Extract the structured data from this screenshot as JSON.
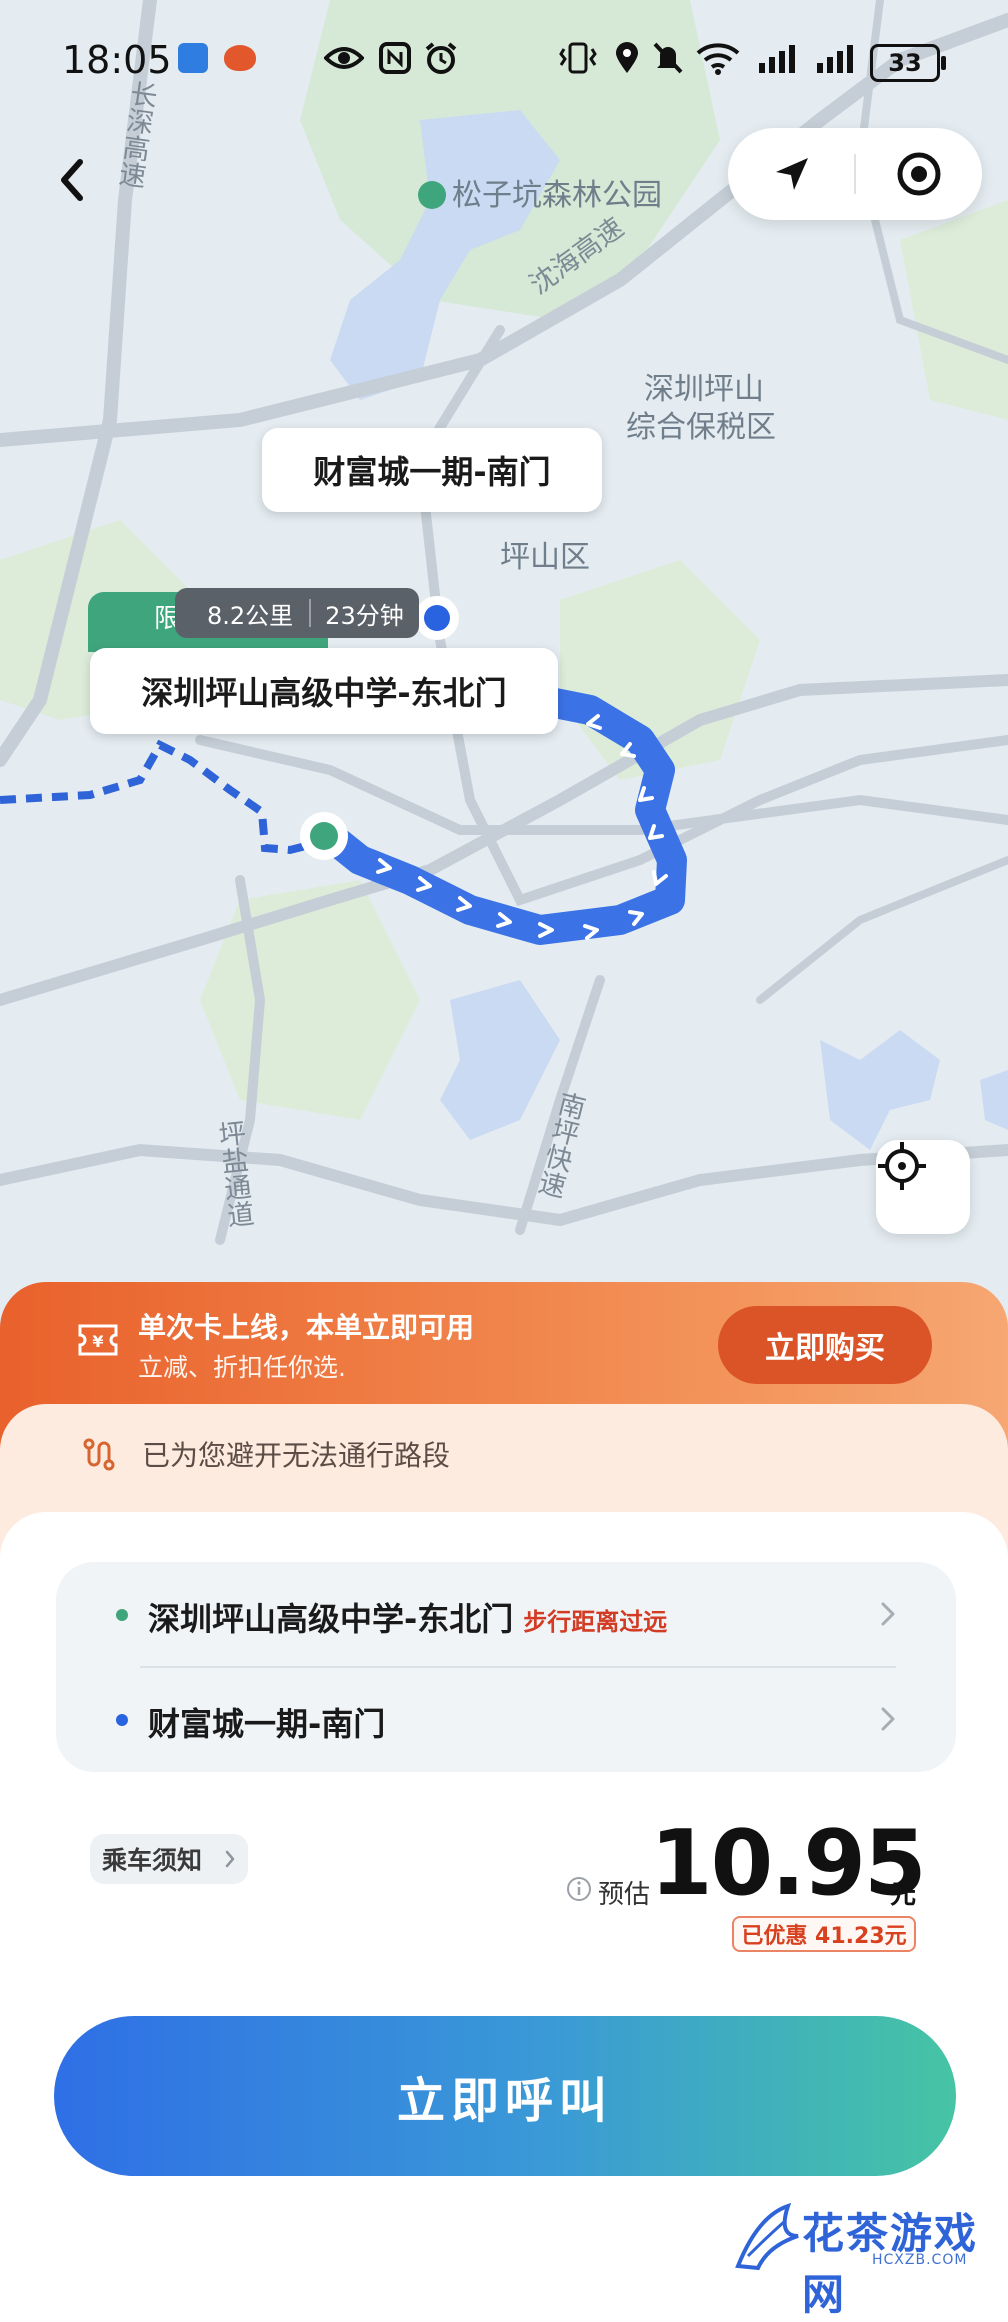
{
  "status_bar": {
    "time": "18:05",
    "battery": "33",
    "icons": [
      "navigation-app-icon",
      "weibo-icon",
      "eye-icon",
      "nfc-icon",
      "alarm-icon",
      "vibrate-icon",
      "location-icon",
      "mute-icon",
      "wifi-icon",
      "signal-icon",
      "signal-icon",
      "battery-icon"
    ]
  },
  "map": {
    "poi_label": "松子坑森林公园",
    "area_label_1": "深圳坪山",
    "area_label_2": "综合保税区",
    "district_label": "坪山区",
    "roads": {
      "changshen": "长深高速",
      "shenhai": "沈海高速",
      "pingyan": "坪盐通道",
      "nanping": "南坪快速"
    },
    "colors": {
      "route": "#3b72e6",
      "origin_marker": "#3fa57c",
      "dest_marker": "#2a63e0",
      "water": "#c9daf2",
      "green": "#d9eadb"
    }
  },
  "bubbles": {
    "destination": "财富城一期-南门",
    "origin": "深圳坪山高级中学-东北门",
    "green_tag": "限停5分钟",
    "distance": "8.2公里",
    "duration": "23分钟"
  },
  "promo": {
    "title": "单次卡上线，本单立即可用",
    "subtitle": "立减、折扣任你选.",
    "buy_label": "立即购买"
  },
  "route_notice": "已为您避开无法通行路段",
  "route": {
    "origin": "深圳坪山高级中学-东北门",
    "origin_warning": "步行距离过远",
    "destination": "财富城一期-南门"
  },
  "ride_notes_label": "乘车须知",
  "price": {
    "estimate_label": "预估",
    "value": "10.95",
    "unit": "元",
    "discount": "已优惠 41.23元"
  },
  "call_label": "立即呼叫",
  "watermark": {
    "text": "花茶游戏网",
    "url": "HCXZB.COM"
  }
}
